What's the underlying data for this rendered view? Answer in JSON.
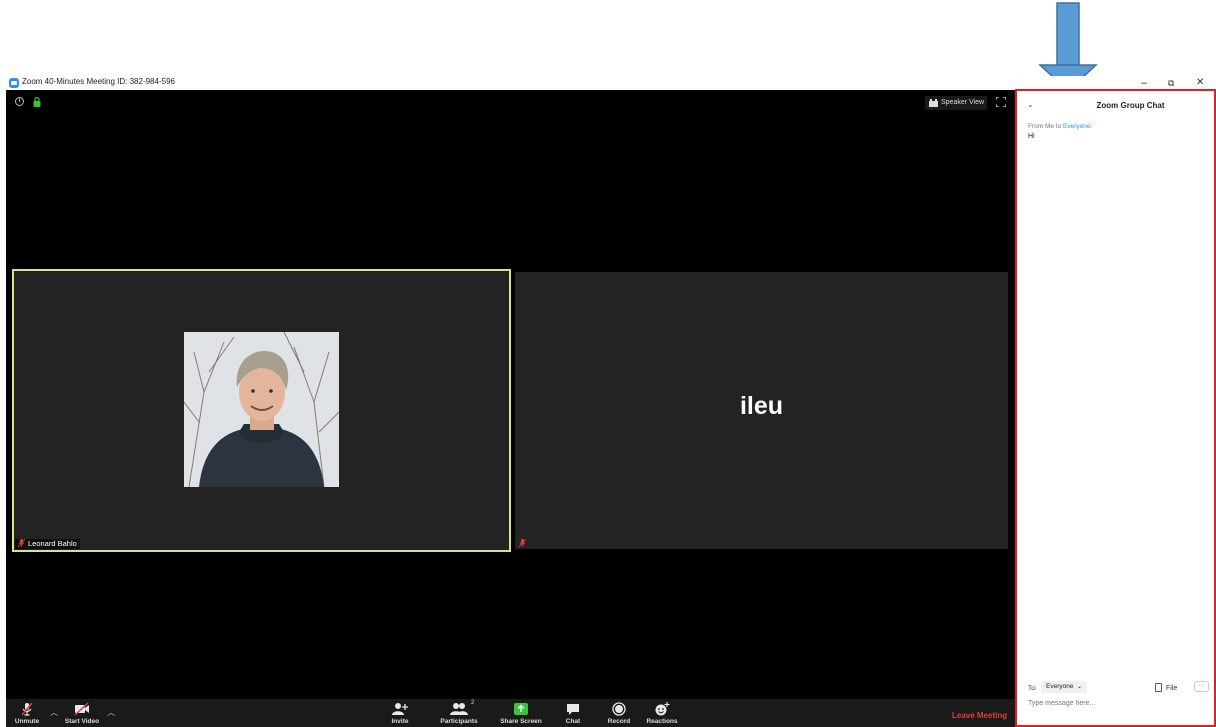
{
  "window": {
    "title": "Zoom 40-Minutes Meeting ID: 382-984-596",
    "minimize": "–",
    "restore": "⧉",
    "close": "✕"
  },
  "meeting": {
    "view_label": "Speaker View",
    "participants": [
      {
        "name": "Leonard Bahlo",
        "video": "on",
        "muted": true,
        "active_speaker": true
      },
      {
        "name": "ileu",
        "video": "off",
        "muted": true,
        "active_speaker": false
      }
    ]
  },
  "toolbar": {
    "unmute": "Unmute",
    "start_video": "Start Video",
    "invite": "Invite",
    "participants": "Participants",
    "participants_count": "2",
    "share_screen": "Share Screen",
    "chat": "Chat",
    "record": "Record",
    "reactions": "Reactions",
    "leave": "Leave Meeting"
  },
  "chat": {
    "title": "Zoom Group Chat",
    "messages": [
      {
        "from_prefix": "From Me to ",
        "to": "Everyone",
        "to_suffix": ":",
        "text": "Hi"
      }
    ],
    "to_label": "To:",
    "recipient": "Everyone",
    "file_label": "File",
    "more_label": "···",
    "input_placeholder": "Type message here..."
  },
  "colors": {
    "accent": "#2d8cff",
    "leave": "#e03e3e",
    "active_border": "#d7e18a",
    "annotation_border": "#e02020",
    "share_green": "#3cc43c"
  }
}
